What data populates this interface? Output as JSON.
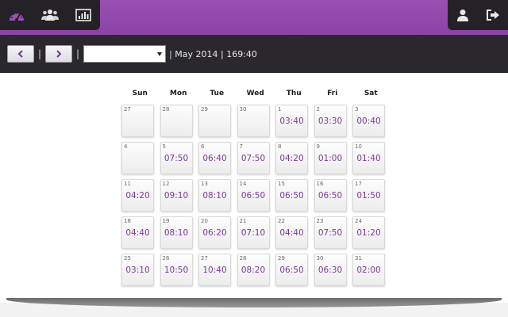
{
  "nav": {
    "left_icons": [
      "dashboard-gauge-icon",
      "users-group-icon",
      "bar-chart-icon"
    ],
    "right_icons": [
      "user-profile-icon",
      "logout-icon"
    ]
  },
  "toolbar": {
    "prev_icon": "chevron-left-icon",
    "next_icon": "chevron-right-icon",
    "separator": "|",
    "select_value": "",
    "summary": "| May 2014 | 169:40"
  },
  "calendar": {
    "weekdays": [
      "Sun",
      "Mon",
      "Tue",
      "Wed",
      "Thu",
      "Fri",
      "Sat"
    ],
    "days": [
      {
        "day": "27",
        "time": ""
      },
      {
        "day": "28",
        "time": ""
      },
      {
        "day": "29",
        "time": ""
      },
      {
        "day": "30",
        "time": ""
      },
      {
        "day": "1",
        "time": "03:40"
      },
      {
        "day": "2",
        "time": "03:30"
      },
      {
        "day": "3",
        "time": "00:40"
      },
      {
        "day": "4",
        "time": ""
      },
      {
        "day": "5",
        "time": "07:50"
      },
      {
        "day": "6",
        "time": "06:40"
      },
      {
        "day": "7",
        "time": "07:50"
      },
      {
        "day": "8",
        "time": "04:20"
      },
      {
        "day": "9",
        "time": "01:00"
      },
      {
        "day": "10",
        "time": "01:40"
      },
      {
        "day": "11",
        "time": "04:20"
      },
      {
        "day": "12",
        "time": "09:10"
      },
      {
        "day": "13",
        "time": "08:10"
      },
      {
        "day": "14",
        "time": "06:50"
      },
      {
        "day": "15",
        "time": "06:50"
      },
      {
        "day": "16",
        "time": "06:50"
      },
      {
        "day": "17",
        "time": "01:50"
      },
      {
        "day": "18",
        "time": "04:40"
      },
      {
        "day": "19",
        "time": "08:10"
      },
      {
        "day": "20",
        "time": "06:20"
      },
      {
        "day": "21",
        "time": "07:10"
      },
      {
        "day": "22",
        "time": "04:40"
      },
      {
        "day": "23",
        "time": "07:50"
      },
      {
        "day": "24",
        "time": "01:20"
      },
      {
        "day": "25",
        "time": "03:10"
      },
      {
        "day": "26",
        "time": "10:50"
      },
      {
        "day": "27",
        "time": "10:40"
      },
      {
        "day": "28",
        "time": "08:20"
      },
      {
        "day": "29",
        "time": "06:50"
      },
      {
        "day": "30",
        "time": "06:30"
      },
      {
        "day": "31",
        "time": "02:00"
      }
    ]
  },
  "colors": {
    "header_purple": "#8e46a9",
    "dark_bar": "#242227",
    "time_text": "#7b3b9a"
  }
}
